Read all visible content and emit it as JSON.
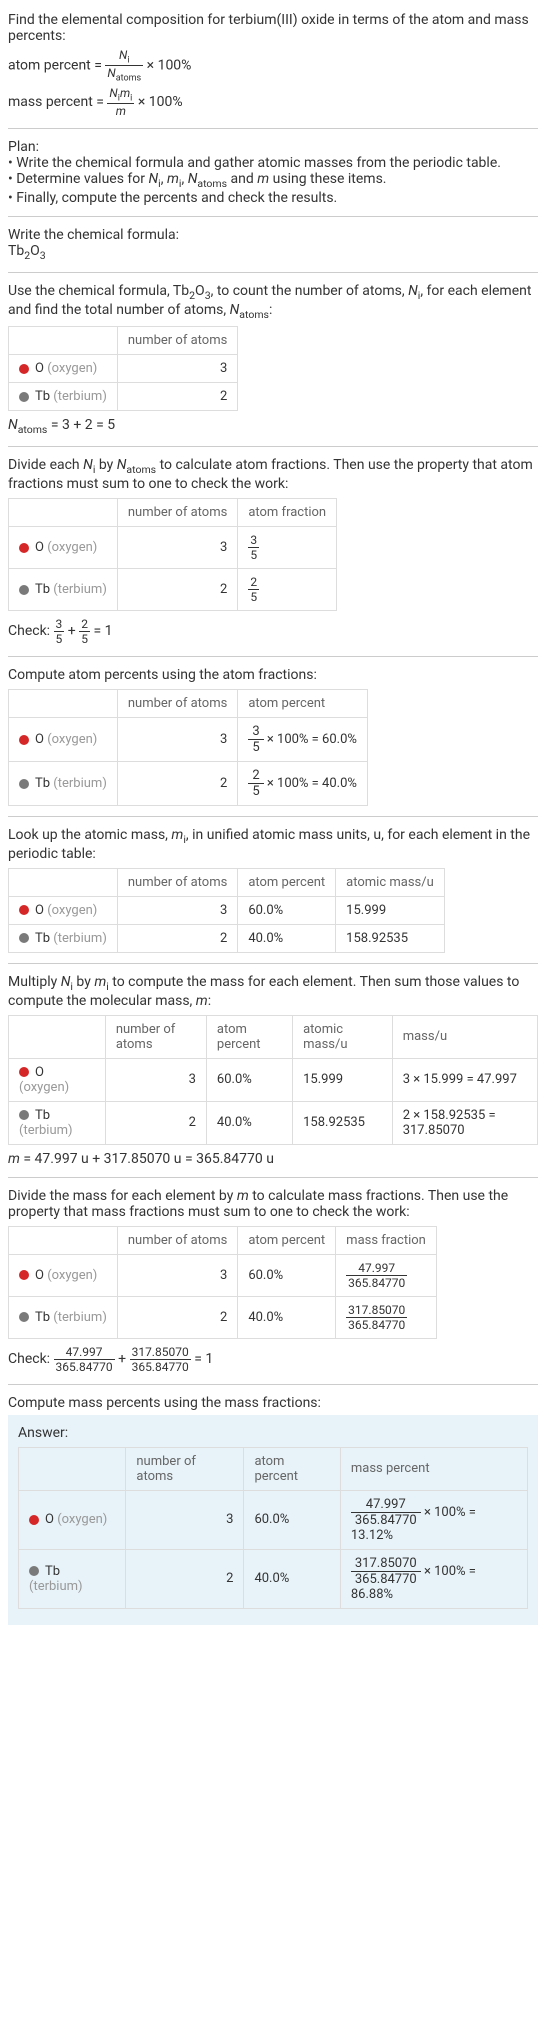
{
  "intro": "Find the elemental composition for terbium(III) oxide in terms of the atom and mass percents:",
  "atom_percent_label": "atom percent = ",
  "atom_percent_frac_num": "N",
  "atom_percent_frac_num_sub": "i",
  "atom_percent_frac_den": "N",
  "atom_percent_frac_den_sub": "atoms",
  "times100": " × 100%",
  "mass_percent_label": "mass percent = ",
  "mass_percent_frac_num": "N",
  "mass_percent_frac_num_sub": "i",
  "mass_percent_frac_num2": "m",
  "mass_percent_frac_num2_sub": "i",
  "mass_percent_frac_den": "m",
  "plan_label": "Plan:",
  "plan1": "• Write the chemical formula and gather atomic masses from the periodic table.",
  "plan2a": "• Determine values for ",
  "plan2_ni": "N",
  "plan2_ni_sub": "i",
  "plan2b": ", ",
  "plan2_mi": "m",
  "plan2_mi_sub": "i",
  "plan2c": ", ",
  "plan2_na": "N",
  "plan2_na_sub": "atoms",
  "plan2d": " and ",
  "plan2_m": "m",
  "plan2e": " using these items.",
  "plan3": "• Finally, compute the percents and check the results.",
  "write_formula_label": "Write the chemical formula:",
  "formula_tb": "Tb",
  "formula_tb_sub": "2",
  "formula_o": "O",
  "formula_o_sub": "3",
  "use_formula_a": "Use the chemical formula, Tb",
  "use_formula_2": "2",
  "use_formula_o": "O",
  "use_formula_3": "3",
  "use_formula_b": ", to count the number of atoms, ",
  "use_formula_c": ", for each element and find the total number of atoms, ",
  "use_formula_d": ":",
  "hdr_number_of_atoms": "number of atoms",
  "hdr_atom_fraction": "atom fraction",
  "hdr_atom_percent": "atom percent",
  "hdr_atomic_mass": "atomic mass/u",
  "hdr_mass": "mass/u",
  "hdr_mass_fraction": "mass fraction",
  "hdr_mass_percent": "mass percent",
  "el_o_sym": "O",
  "el_o_name": "(oxygen)",
  "el_tb_sym": "Tb",
  "el_tb_name": "(terbium)",
  "o_atoms": "3",
  "tb_atoms": "2",
  "natoms_eq_a": "N",
  "natoms_eq_sub": "atoms",
  "natoms_eq_b": " = 3 + 2 = 5",
  "divide_text_a": "Divide each ",
  "divide_text_b": " by ",
  "divide_text_c": " to calculate atom fractions. Then use the property that atom fractions must sum to one to check the work:",
  "frac_o_num": "3",
  "frac_o_den": "5",
  "frac_tb_num": "2",
  "frac_tb_den": "5",
  "check1_a": "Check: ",
  "check1_b": " + ",
  "check1_c": " = 1",
  "compute_atom_pct": "Compute atom percents using the atom fractions:",
  "o_pct_eq": " × 100% = 60.0%",
  "tb_pct_eq": " × 100% = 40.0%",
  "lookup_text_a": "Look up the atomic mass, ",
  "lookup_text_b": ", in unified atomic mass units, u, for each element in the periodic table:",
  "o_pct": "60.0%",
  "tb_pct": "40.0%",
  "o_mass": "15.999",
  "tb_mass": "158.92535",
  "multiply_text_a": "Multiply ",
  "multiply_text_b": " by ",
  "multiply_text_c": " to compute the mass for each element. Then sum those values to compute the molecular mass, ",
  "multiply_text_d": ":",
  "o_mass_eq": "3 × 15.999 = 47.997",
  "tb_mass_eq": "2 × 158.92535 = 317.85070",
  "m_eq_a": "m",
  "m_eq_b": " = 47.997 u + 317.85070 u = 365.84770 u",
  "divide_mass_text_a": "Divide the mass for each element by ",
  "divide_mass_text_b": " to calculate mass fractions. Then use the property that mass fractions must sum to one to check the work:",
  "o_massfrac_num": "47.997",
  "o_massfrac_den": "365.84770",
  "tb_massfrac_num": "317.85070",
  "tb_massfrac_den": "365.84770",
  "check2_a": "Check: ",
  "check2_b": " + ",
  "check2_c": " = 1",
  "compute_mass_pct": "Compute mass percents using the mass fractions:",
  "answer_label": "Answer:",
  "o_masspct_eq": " × 100% = 13.12%",
  "tb_masspct_eq": " × 100% = 86.88%",
  "chart_data": {
    "type": "table",
    "title": "Elemental composition of terbium(III) oxide",
    "elements": [
      {
        "symbol": "O",
        "name": "oxygen",
        "atoms": 3,
        "atom_percent": 60.0,
        "atomic_mass_u": 15.999,
        "mass_u": 47.997,
        "mass_percent": 13.12
      },
      {
        "symbol": "Tb",
        "name": "terbium",
        "atoms": 2,
        "atom_percent": 40.0,
        "atomic_mass_u": 158.92535,
        "mass_u": 317.8507,
        "mass_percent": 86.88
      }
    ],
    "N_atoms": 5,
    "molecular_mass_u": 365.8477
  }
}
